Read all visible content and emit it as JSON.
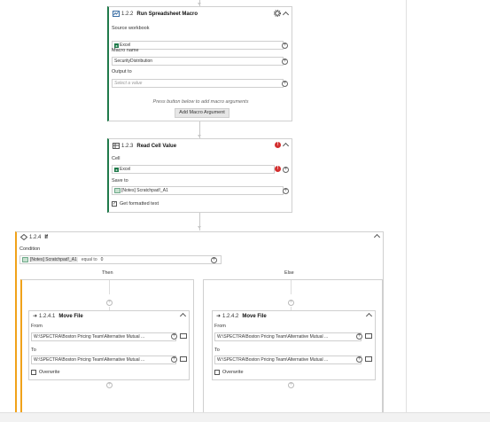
{
  "macro": {
    "number": "1.2.2",
    "title": "Run Spreadsheet Macro",
    "source_label": "Source workbook",
    "source_value": "Excel",
    "macro_label": "Macro name",
    "macro_value": "SecurityDistribution",
    "output_label": "Output to",
    "output_placeholder": "Select a value",
    "hint": "Press button below to add macro arguments",
    "add_button": "Add Macro Argument",
    "colors": {
      "accent": "#1f7a4a"
    }
  },
  "read_cell": {
    "number": "1.2.3",
    "title": "Read Cell Value",
    "cell_label": "Cell",
    "cell_value": "Excel",
    "save_label": "Save to",
    "save_value": "[Notes] Scratchpad!_A1",
    "checkbox_label": "Get formatted text",
    "checkbox_checked": true,
    "colors": {
      "error": "#d32f2f"
    }
  },
  "if_block": {
    "number": "1.2.4",
    "title": "If",
    "condition_label": "Condition",
    "condition_left": "[Notes] Scratchpad!_A1",
    "operator": "equal to",
    "condition_right": "0",
    "then_label": "Then",
    "else_label": "Else",
    "colors": {
      "accent": "#f0a21a"
    }
  },
  "move_then": {
    "number": "1.2.4.1",
    "title": "Move File",
    "from_label": "From",
    "from_value": "W:\\SPECTRA\\Boston Pricing Team\\Alternative Mutual ...",
    "to_label": "To",
    "to_value": "W:\\SPECTRA\\Boston Pricing Team\\Alternative Mutual ...",
    "overwrite_label": "Overwrite"
  },
  "move_else": {
    "number": "1.2.4.2",
    "title": "Move File",
    "from_label": "From",
    "from_value": "W:\\SPECTRA\\Boston Pricing Team\\Alternative Mutual ...",
    "to_label": "To",
    "to_value": "W:\\SPECTRA\\Boston Pricing Team\\Alternative Mutual ...",
    "overwrite_label": "Overwrite"
  }
}
